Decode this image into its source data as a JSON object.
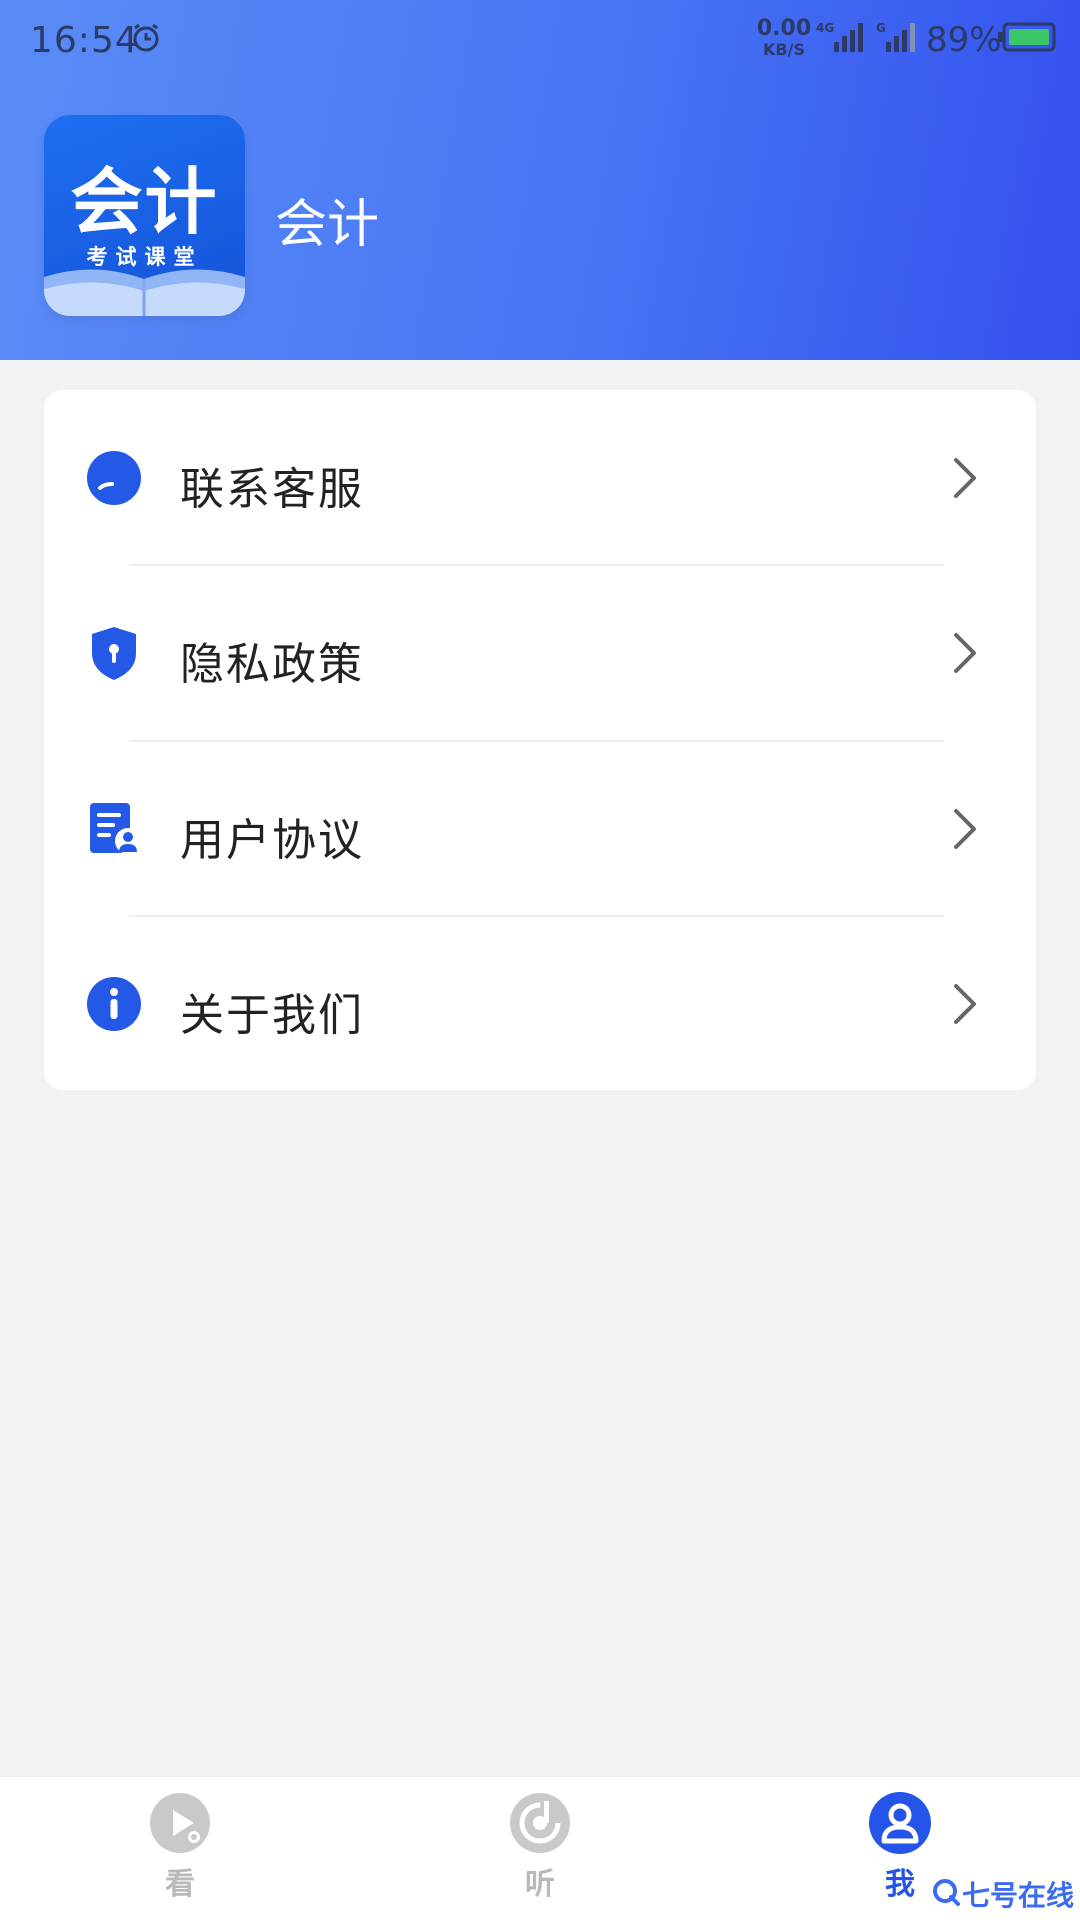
{
  "status_bar": {
    "time": "16:54",
    "net_speed_value": "0.00",
    "net_speed_unit": "KB/S",
    "signal_1_label": "4G",
    "signal_2_label": "G",
    "battery_percent": "89%"
  },
  "header": {
    "logo_main_text": "会计",
    "logo_sub_text": "考试课堂",
    "app_name": "会计"
  },
  "menu": {
    "items": [
      {
        "label": "联系客服",
        "icon": "customer-service-icon"
      },
      {
        "label": "隐私政策",
        "icon": "shield-lock-icon"
      },
      {
        "label": "用户协议",
        "icon": "document-user-icon"
      },
      {
        "label": "关于我们",
        "icon": "info-icon"
      }
    ]
  },
  "bottom_nav": {
    "items": [
      {
        "label": "看",
        "icon": "play-icon",
        "active": false
      },
      {
        "label": "听",
        "icon": "music-icon",
        "active": false
      },
      {
        "label": "我",
        "icon": "profile-icon",
        "active": true
      }
    ]
  },
  "watermark": {
    "text": "七号在线"
  },
  "colors": {
    "primary": "#2455e8",
    "header_gradient_start": "#5a8cf6",
    "header_gradient_end": "#3350ee",
    "inactive_nav": "#b9b9bd",
    "page_background": "#f2f2f4"
  }
}
